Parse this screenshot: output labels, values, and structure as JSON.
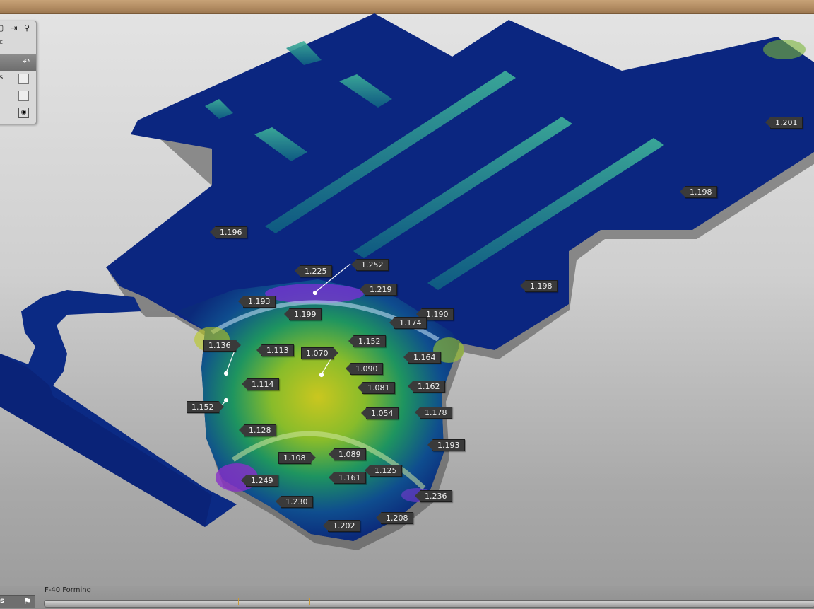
{
  "stage_label": "F-40 Forming",
  "panel": {
    "subtitle": "c",
    "rows": [
      {
        "label": "s",
        "control": "checkbox"
      },
      {
        "label": "",
        "control": "checkbox"
      },
      {
        "label": "",
        "control": "eye"
      }
    ]
  },
  "bottom_tab": {
    "label": "s"
  },
  "measurements": [
    {
      "value": "1.201"
    },
    {
      "value": "1.198"
    },
    {
      "value": "1.196"
    },
    {
      "value": "1.198"
    },
    {
      "value": "1.225"
    },
    {
      "value": "1.252"
    },
    {
      "value": "1.219"
    },
    {
      "value": "1.193"
    },
    {
      "value": "1.199"
    },
    {
      "value": "1.190"
    },
    {
      "value": "1.174"
    },
    {
      "value": "1.136"
    },
    {
      "value": "1.113"
    },
    {
      "value": "1.070"
    },
    {
      "value": "1.152"
    },
    {
      "value": "1.164"
    },
    {
      "value": "1.090"
    },
    {
      "value": "1.114"
    },
    {
      "value": "1.081"
    },
    {
      "value": "1.162"
    },
    {
      "value": "1.152"
    },
    {
      "value": "1.054"
    },
    {
      "value": "1.178"
    },
    {
      "value": "1.128"
    },
    {
      "value": "1.193"
    },
    {
      "value": "1.108"
    },
    {
      "value": "1.089"
    },
    {
      "value": "1.125"
    },
    {
      "value": "1.161"
    },
    {
      "value": "1.249"
    },
    {
      "value": "1.236"
    },
    {
      "value": "1.230"
    },
    {
      "value": "1.208"
    },
    {
      "value": "1.202"
    }
  ]
}
